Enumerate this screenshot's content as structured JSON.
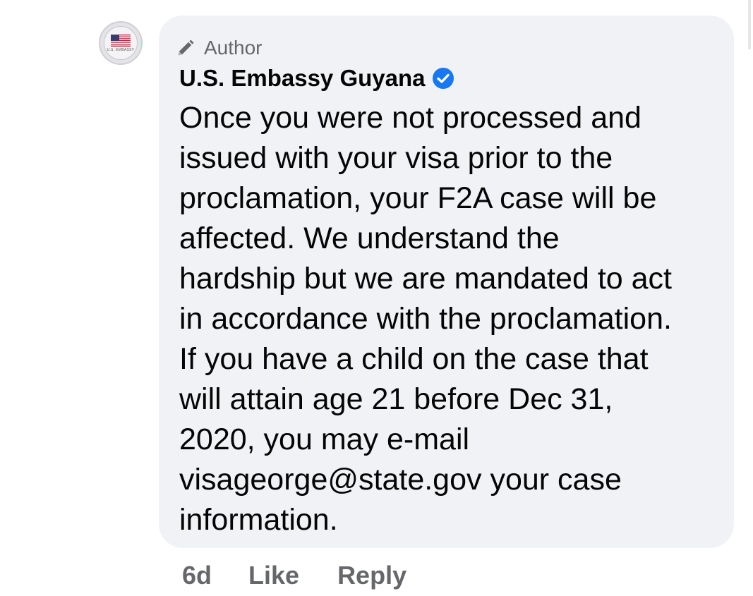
{
  "avatar": {
    "caption": "U.S. EMBASSY",
    "icon": "us-flag-icon"
  },
  "comment": {
    "badge_label": "Author",
    "badge_icon": "pencil-icon",
    "author_name": "U.S. Embassy Guyana",
    "verified_icon": "verified-badge-icon",
    "text": "Once you were not processed and\nissued with your visa prior to the\nproclamation, your F2A case will be\naffected. We understand the\nhardship but we are mandated to act\nin accordance with the proclamation.\nIf you have a child on the case that\nwill attain age 21 before Dec 31,\n2020, you may e-mail\nvisageorge@state.gov your case\ninformation."
  },
  "actions": {
    "timestamp": "6d",
    "like_label": "Like",
    "reply_label": "Reply"
  },
  "colors": {
    "bubble_bg": "#f0f2f5",
    "meta_text": "#65676b",
    "verified_blue": "#1877f2",
    "text": "#050505"
  }
}
